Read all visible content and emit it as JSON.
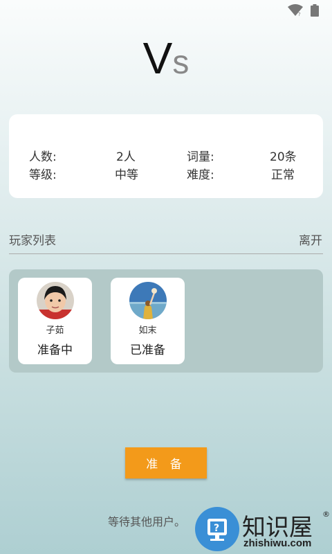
{
  "vs_title": {
    "v": "V",
    "s": "s"
  },
  "info": {
    "players_label": "人数:",
    "players_value": "2人",
    "words_label": "词量:",
    "words_value": "20条",
    "level_label": "等级:",
    "level_value": "中等",
    "difficulty_label": "难度:",
    "difficulty_value": "正常"
  },
  "player_list": {
    "title": "玩家列表",
    "leave_label": "离开"
  },
  "players": [
    {
      "name": "子茹",
      "status": "准备中"
    },
    {
      "name": "如末",
      "status": "已准备"
    }
  ],
  "ready_button": "准 备",
  "waiting_text": "等待其他用户。",
  "watermark": {
    "title": "知识屋",
    "url": "zhishiwu.com",
    "reg": "®"
  },
  "colors": {
    "accent": "#f39a1a",
    "card": "#ffffff",
    "player_area": "#b3c9c8"
  }
}
